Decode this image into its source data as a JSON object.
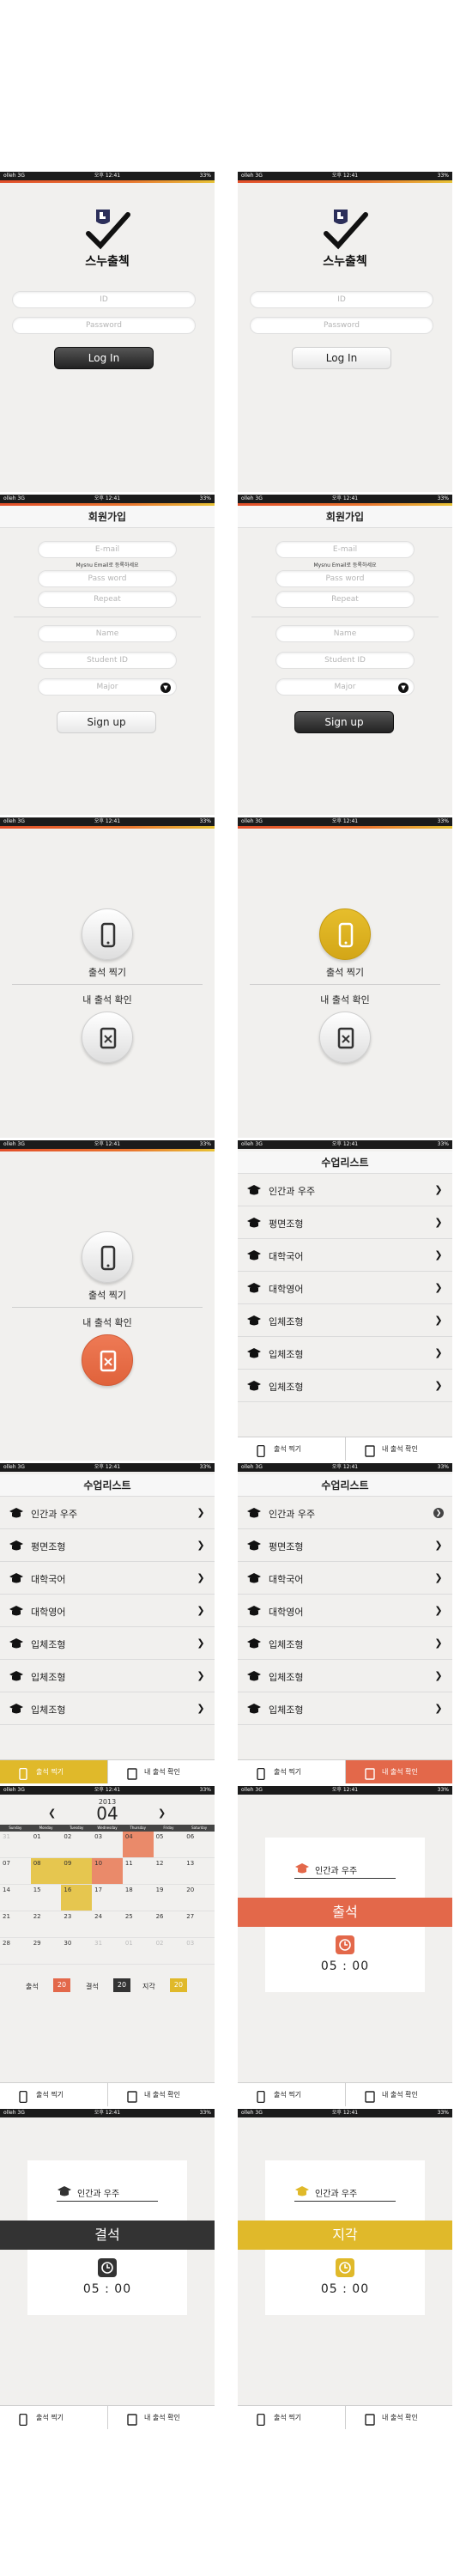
{
  "status": {
    "carrier": "olleh  3G",
    "time": "오후 12:41",
    "battery": "33%"
  },
  "brand": {
    "title": "스누출첵"
  },
  "login": {
    "id_placeholder": "ID",
    "password_placeholder": "Password",
    "login_label": "Log In"
  },
  "signup": {
    "title": "회원가입",
    "email_placeholder": "E-mail",
    "email_hint": "Mysnu Email로 등록하세요",
    "password_placeholder": "Pass word",
    "repeat_placeholder": "Repeat",
    "name_placeholder": "Name",
    "student_id_placeholder": "Student ID",
    "major_placeholder": "Major",
    "signup_label": "Sign up"
  },
  "menu": {
    "checkin_label": "출석 찍기",
    "mycheck_label": "내 출석 확인"
  },
  "classlist": {
    "title": "수업리스트",
    "items": [
      "인간과 우주",
      "평면조형",
      "대학국어",
      "대학영어",
      "입체조형",
      "입체조형",
      "입체조형"
    ]
  },
  "tabs": {
    "checkin": "출석 찍기",
    "mycheck": "내 출석 확인"
  },
  "calendar": {
    "year": "2013",
    "month": "04",
    "weekdays": [
      "Sunday",
      "Monday",
      "Tuesday",
      "Wednesday",
      "Thursday",
      "Friday",
      "Saturday"
    ],
    "days": [
      [
        "31",
        "01",
        "02",
        "03",
        "04",
        "05",
        "06"
      ],
      [
        "07",
        "08",
        "09",
        "10",
        "11",
        "12",
        "13"
      ],
      [
        "14",
        "15",
        "16",
        "17",
        "18",
        "19",
        "20"
      ],
      [
        "21",
        "22",
        "23",
        "24",
        "25",
        "26",
        "27"
      ],
      [
        "28",
        "29",
        "30",
        "31",
        "01",
        "02",
        "03"
      ]
    ],
    "attend_label": "출석",
    "attend_count": "20",
    "absent_label": "결석",
    "absent_count": "20",
    "late_label": "지각",
    "late_count": "20"
  },
  "result": {
    "course": "인간과 우주",
    "attend": "출석",
    "absent": "결석",
    "late": "지각",
    "time": "05 : 00"
  },
  "colors": {
    "coral": "#e3684a",
    "gold": "#e0b92a",
    "dark": "#333333",
    "background": "#f1f0ee"
  }
}
